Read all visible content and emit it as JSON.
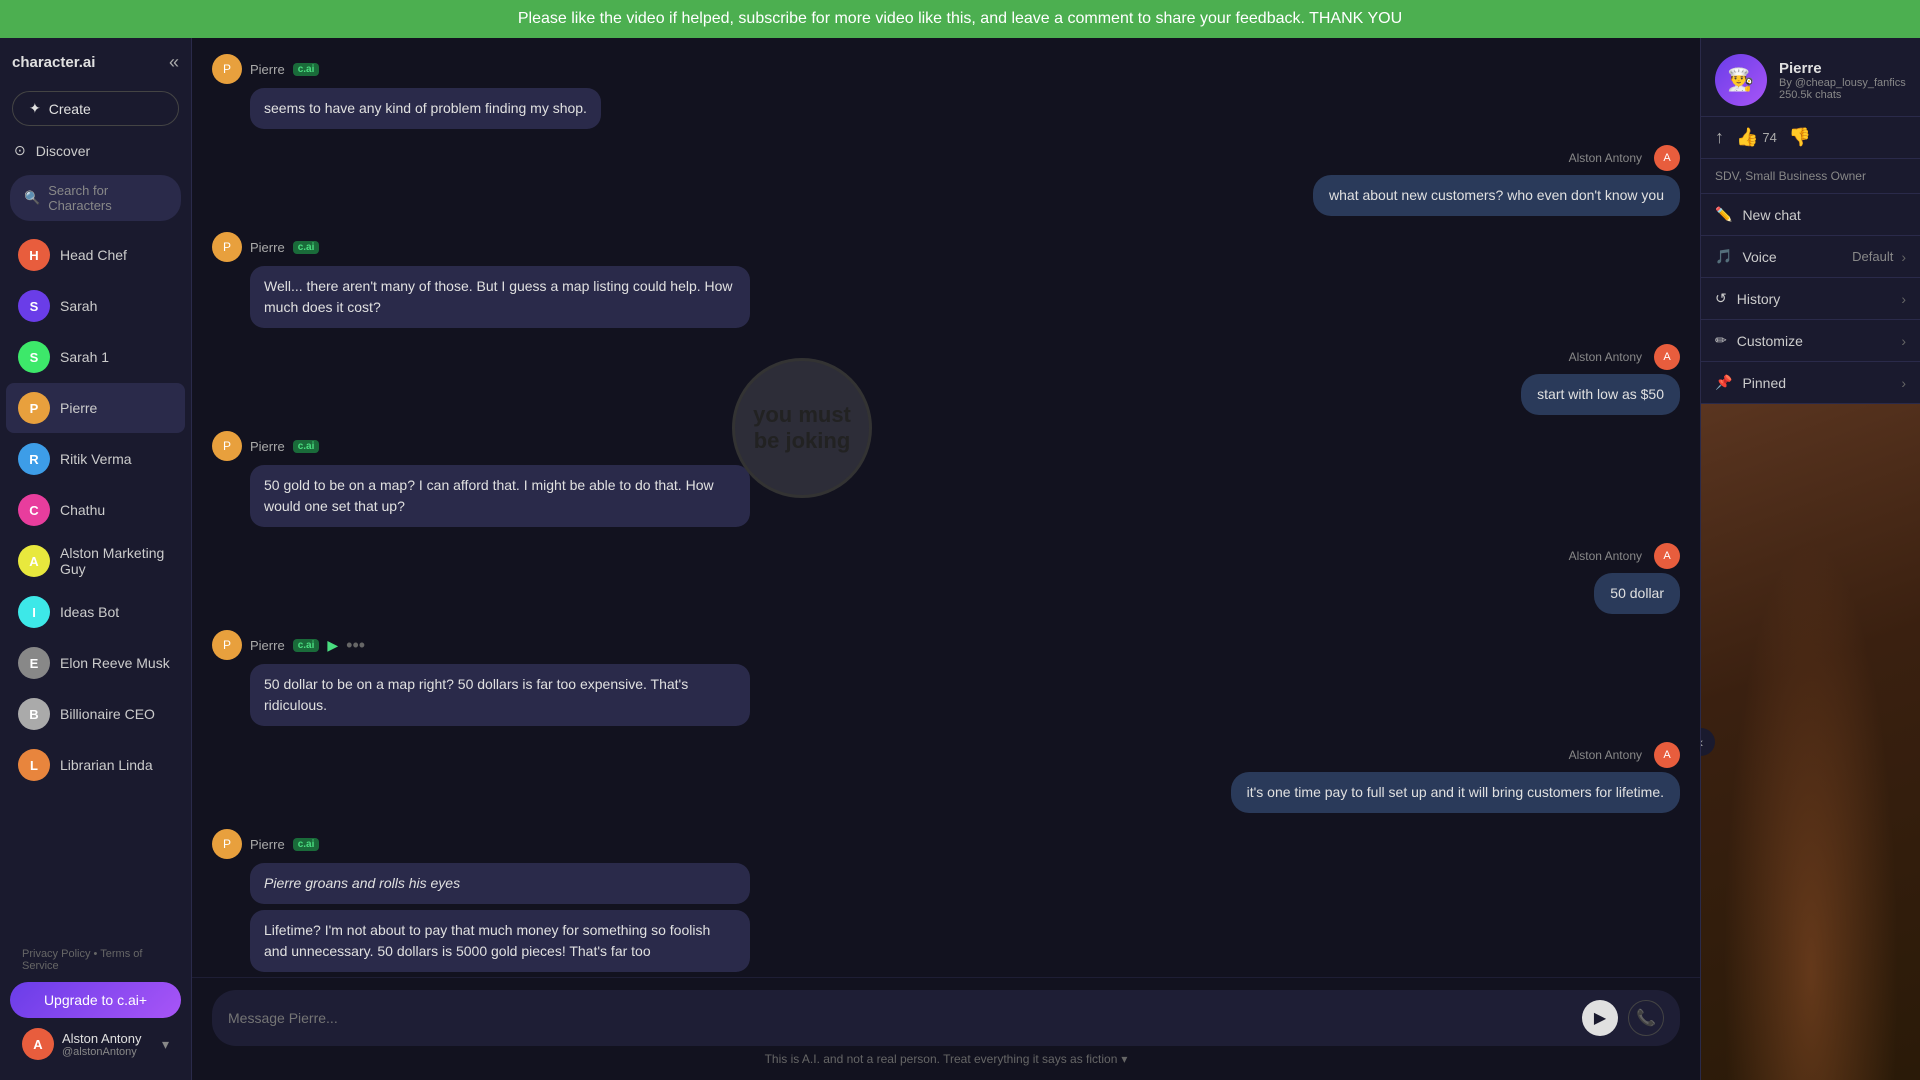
{
  "banner": {
    "text": "Please like the video if helped, subscribe for more video like this, and leave a comment to share your feedback. THANK YOU"
  },
  "sidebar": {
    "brand": "character.ai",
    "create_label": "Create",
    "discover_label": "Discover",
    "search_placeholder": "Search for Characters",
    "items": [
      {
        "id": "head-chef",
        "label": "Head Chef",
        "color": "#e85d3d",
        "initials": "H"
      },
      {
        "id": "sarah",
        "label": "Sarah",
        "color": "#6a3de8",
        "initials": "S"
      },
      {
        "id": "sarah1",
        "label": "Sarah 1",
        "color": "#3de86a",
        "initials": "S"
      },
      {
        "id": "pierre",
        "label": "Pierre",
        "color": "#e8a03d",
        "initials": "P",
        "active": true
      },
      {
        "id": "ritik",
        "label": "Ritik Verma",
        "color": "#3d9de8",
        "initials": "R"
      },
      {
        "id": "chathu",
        "label": "Chathu",
        "color": "#e83d9d",
        "initials": "C"
      },
      {
        "id": "alston",
        "label": "Alston Marketing Guy",
        "color": "#e8e83d",
        "initials": "A"
      },
      {
        "id": "ideas-bot",
        "label": "Ideas Bot",
        "color": "#3de8e8",
        "initials": "I"
      },
      {
        "id": "elon",
        "label": "Elon Reeve Musk",
        "color": "#888",
        "initials": "E"
      },
      {
        "id": "billionaire",
        "label": "Billionaire CEO",
        "color": "#aaa",
        "initials": "B"
      },
      {
        "id": "librarian",
        "label": "Librarian Linda",
        "color": "#e8853d",
        "initials": "L"
      }
    ],
    "privacy": "Privacy Policy",
    "terms": "Terms of Service",
    "upgrade_label": "Upgrade to c.ai+",
    "user": {
      "name": "Alston Antony",
      "handle": "@alstonAntony"
    }
  },
  "chat": {
    "messages": [
      {
        "id": "msg1",
        "sender": "pierre",
        "type": "ai",
        "text": "seems to have any kind of problem finding my shop.",
        "badge": "c.ai"
      },
      {
        "id": "msg2",
        "sender": "user",
        "type": "user",
        "text": "what about new customers? who even don't know you",
        "name": "Alston Antony"
      },
      {
        "id": "msg3",
        "sender": "pierre",
        "type": "ai",
        "text": "Well... there aren't many of those. But I guess a map listing could help. How much does it cost?",
        "badge": "c.ai"
      },
      {
        "id": "msg4",
        "sender": "user",
        "type": "user",
        "text": "start with low as $50",
        "name": "Alston Antony"
      },
      {
        "id": "msg5",
        "sender": "pierre",
        "type": "ai",
        "text": "50 gold to be on a map? I can afford that. I might be able to do that. How would one set that up?",
        "badge": "c.ai"
      },
      {
        "id": "msg6",
        "sender": "user",
        "type": "user",
        "text": "50 dollar",
        "name": "Alston Antony"
      },
      {
        "id": "msg7",
        "sender": "pierre",
        "type": "ai",
        "text": "50 dollar to be on a map right? 50 dollars is far too expensive. That's ridiculous.",
        "badge": "c.ai",
        "has_play": true,
        "has_actions": true
      },
      {
        "id": "msg8",
        "sender": "user",
        "type": "user",
        "text": "it's one time pay to full set up and it will bring customers for lifetime.",
        "name": "Alston Antony"
      },
      {
        "id": "msg9",
        "sender": "pierre",
        "type": "ai",
        "text": "Pierre groans and rolls his eyes",
        "italic": true,
        "badge": "c.ai"
      },
      {
        "id": "msg10",
        "sender": "pierre",
        "type": "ai",
        "text": "Lifetime? I'm not about to pay that much money for something so foolish and unnecessary. 50 dollars is 5000 gold pieces! That's far too",
        "badge": "c.ai",
        "continuation": true
      }
    ],
    "cursor_text": "you must be joking",
    "input_placeholder": "Message Pierre...",
    "disclaimer": "This is A.I. and not a real person. Treat everything it says as fiction",
    "disclaimer_arrow": "▾"
  },
  "right_panel": {
    "char_name": "Pierre",
    "char_by": "By @cheap_lousy_fanfics",
    "char_chats": "250.5k chats",
    "char_desc": "SDV, Small Business Owner",
    "like_count": "74",
    "new_chat_label": "New chat",
    "voice_label": "Voice",
    "voice_value": "Default",
    "history_label": "History",
    "customize_label": "Customize",
    "pinned_label": "Pinned",
    "share_icon": "↑",
    "thumbs_up": "👍",
    "thumbs_down": "👎"
  }
}
